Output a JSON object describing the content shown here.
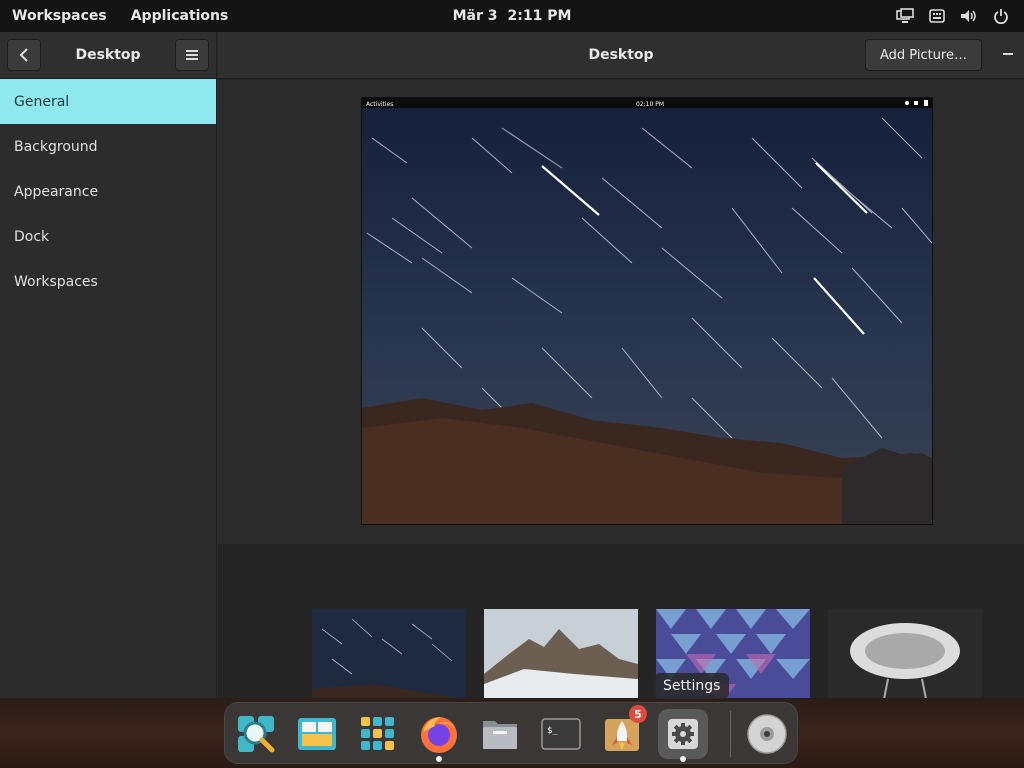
{
  "topbar": {
    "workspaces": "Workspaces",
    "applications": "Applications",
    "date": "Mär 3",
    "time": "2:11 PM"
  },
  "sidebar": {
    "title": "Desktop",
    "items": [
      {
        "label": "General",
        "active": true
      },
      {
        "label": "Background"
      },
      {
        "label": "Appearance"
      },
      {
        "label": "Dock"
      },
      {
        "label": "Workspaces"
      }
    ]
  },
  "content": {
    "title": "Desktop",
    "add_picture": "Add Picture…"
  },
  "preview": {
    "activities": "Activities",
    "time": "02:10 PM"
  },
  "dock": {
    "tooltip": "Settings",
    "badge_count": "5",
    "items": [
      "search-app",
      "multitasking-app",
      "app-grid",
      "firefox",
      "files",
      "terminal",
      "appcenter",
      "settings",
      "disk"
    ]
  },
  "colors": {
    "accent": "#8ee8ee",
    "badge": "#e04a3f"
  }
}
